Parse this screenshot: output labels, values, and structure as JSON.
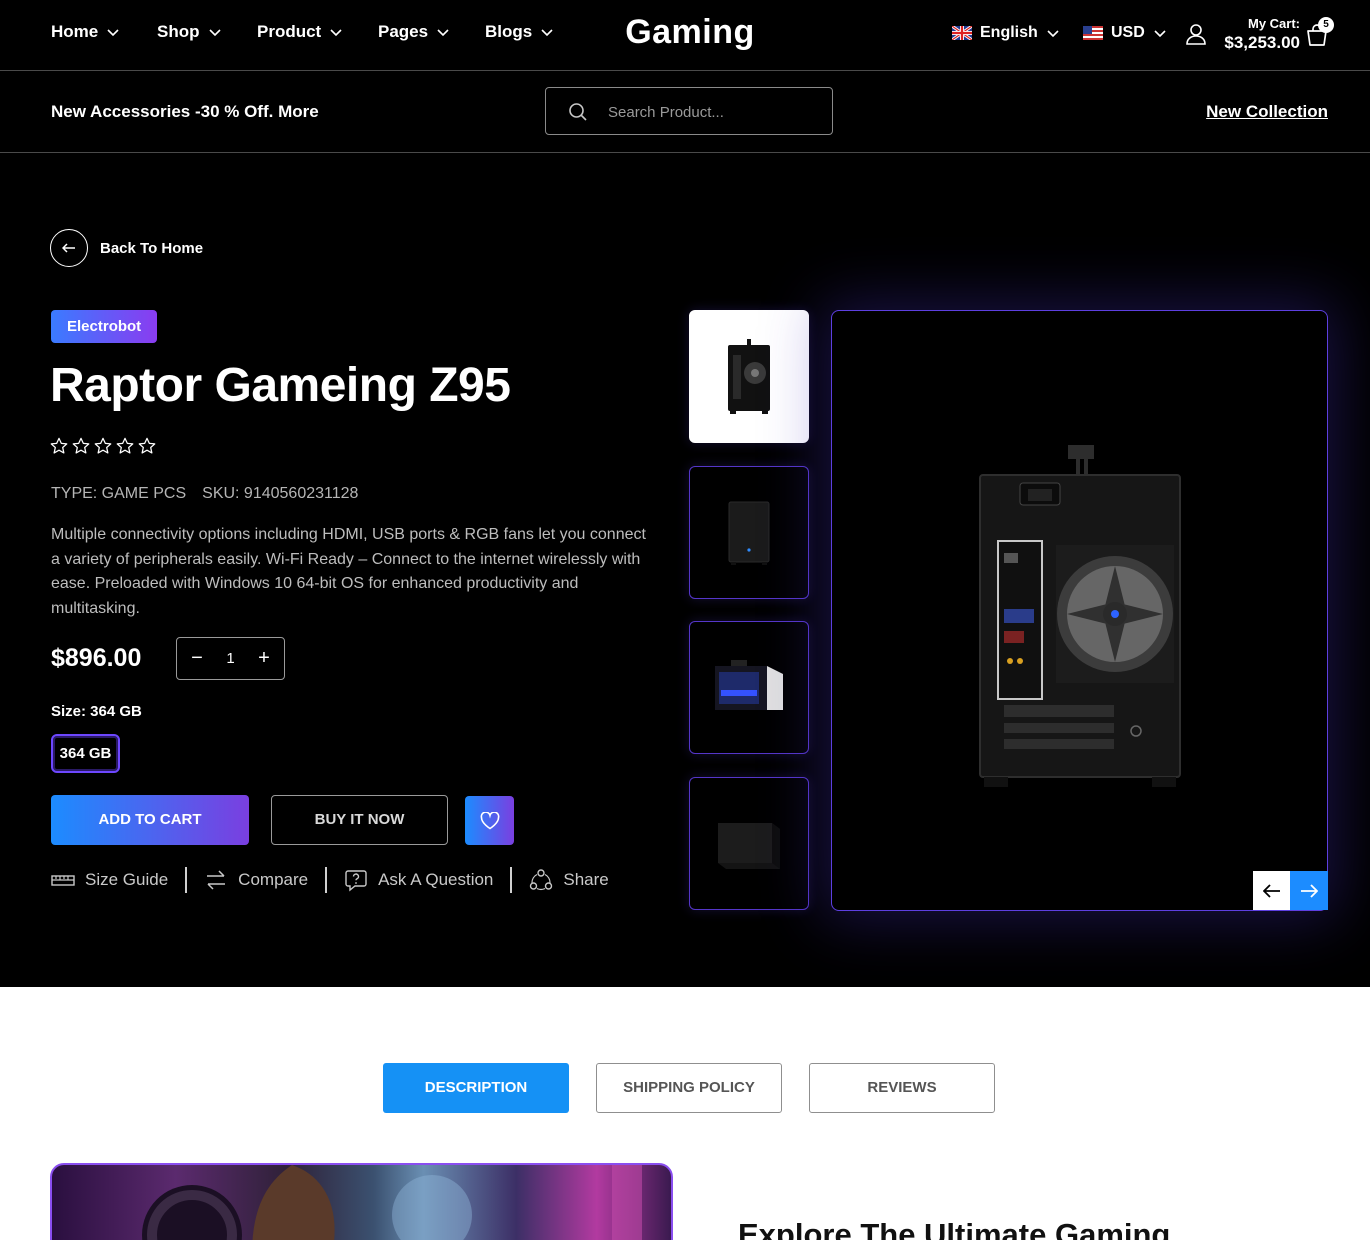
{
  "nav": {
    "items": [
      "Home",
      "Shop",
      "Product",
      "Pages",
      "Blogs"
    ],
    "logo": "Gaming",
    "language": "English",
    "currency": "USD",
    "cart_label": "My Cart:",
    "cart_total": "$3,253.00",
    "cart_count": "5"
  },
  "subbar": {
    "promo": "New Accessories -30 % Off. More",
    "search_placeholder": "Search Product...",
    "new_collection": "New Collection"
  },
  "product": {
    "back_label": "Back To Home",
    "vendor": "Electrobot",
    "title": "Raptor Gameing Z95",
    "rating": 0,
    "type": "TYPE: GAME PCS",
    "sku": "SKU: 9140560231128",
    "description": "Multiple connectivity options including HDMI, USB ports & RGB fans let you connect a variety of peripherals easily. Wi-Fi Ready – Connect to the internet wirelessly with ease. Preloaded with Windows 10 64-bit OS for enhanced productivity and multitasking.",
    "price": "$896.00",
    "quantity": "1",
    "size_label": "Size: 364 GB",
    "size_option": "364 GB",
    "add_to_cart": "ADD TO CART",
    "buy_now": "BUY IT NOW",
    "actions": [
      "Size Guide",
      "Compare",
      "Ask A Question",
      "Share"
    ]
  },
  "tabs": [
    "DESCRIPTION",
    "SHIPPING POLICY",
    "REVIEWS"
  ],
  "section_heading": "Explore The Ultimate Gaming",
  "colors": {
    "accent_blue": "#1591f5",
    "accent_purple": "#7a3fe0",
    "background": "#000000"
  }
}
